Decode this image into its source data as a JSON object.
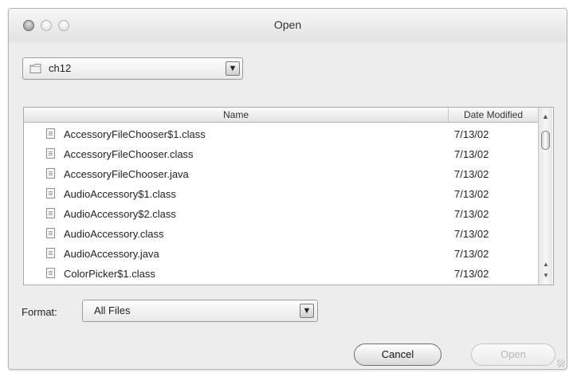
{
  "window": {
    "title": "Open"
  },
  "location": {
    "folder": "ch12"
  },
  "file_list": {
    "columns": [
      "Name",
      "Date Modified"
    ],
    "rows": [
      {
        "name": "AccessoryFileChooser$1.class",
        "date": "7/13/02",
        "kind": "class-file-icon"
      },
      {
        "name": "AccessoryFileChooser.class",
        "date": "7/13/02",
        "kind": "class-file-icon"
      },
      {
        "name": "AccessoryFileChooser.java",
        "date": "7/13/02",
        "kind": "java-file-icon"
      },
      {
        "name": "AudioAccessory$1.class",
        "date": "7/13/02",
        "kind": "class-file-icon"
      },
      {
        "name": "AudioAccessory$2.class",
        "date": "7/13/02",
        "kind": "class-file-icon"
      },
      {
        "name": "AudioAccessory.class",
        "date": "7/13/02",
        "kind": "class-file-icon"
      },
      {
        "name": "AudioAccessory.java",
        "date": "7/13/02",
        "kind": "java-file-icon"
      },
      {
        "name": "ColorPicker$1.class",
        "date": "7/13/02",
        "kind": "class-file-icon"
      }
    ]
  },
  "format": {
    "label": "Format:",
    "selected": "All Files"
  },
  "buttons": {
    "cancel": "Cancel",
    "open": "Open"
  },
  "icons": {
    "popup_arrow": "▼",
    "scroll_up_top": "▲",
    "scroll_up": "▲",
    "scroll_down": "▼"
  }
}
